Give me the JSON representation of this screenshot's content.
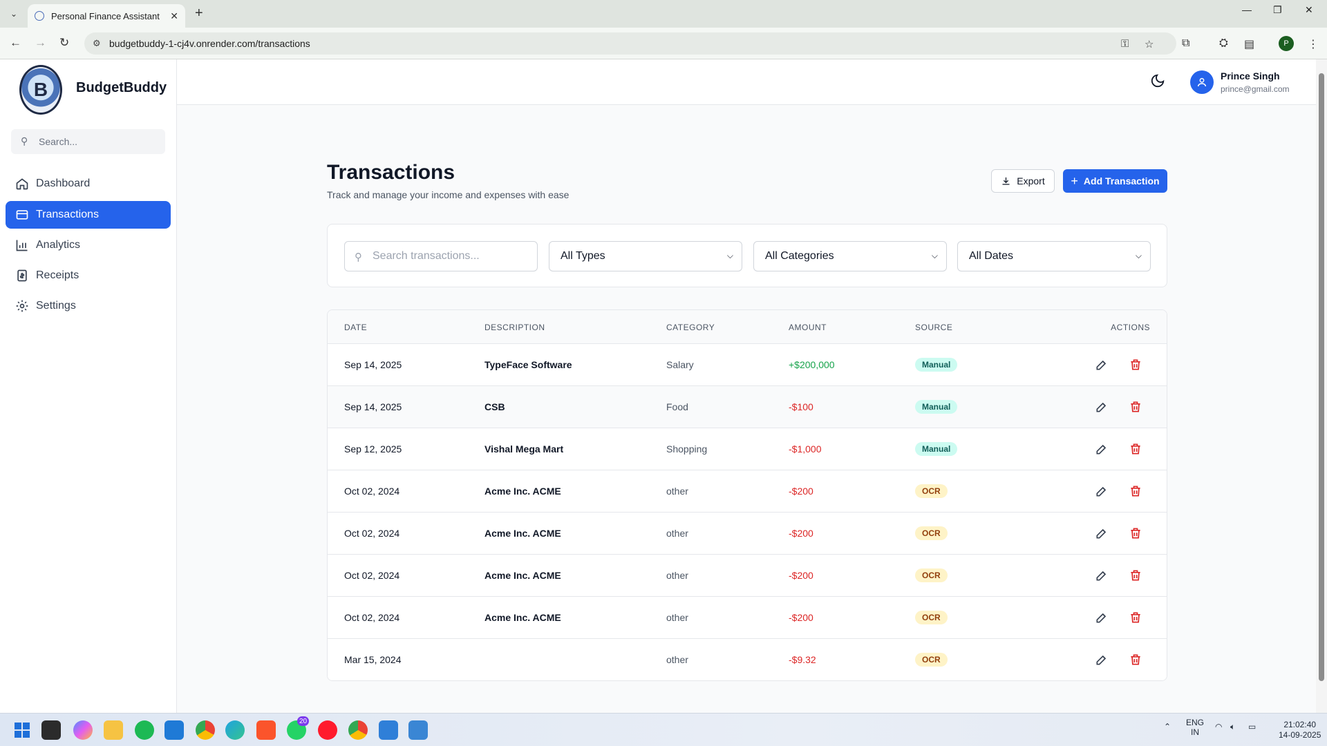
{
  "browser": {
    "tab_title": "Personal Finance Assistant",
    "url": "budgetbuddy-1-cj4v.onrender.com/transactions",
    "profile_initial": "P"
  },
  "sidebar": {
    "brand": "BudgetBuddy",
    "search_placeholder": "Search...",
    "items": [
      {
        "label": "Dashboard",
        "icon": "home-icon"
      },
      {
        "label": "Transactions",
        "icon": "card-icon",
        "active": true
      },
      {
        "label": "Analytics",
        "icon": "bar-chart-icon"
      },
      {
        "label": "Receipts",
        "icon": "receipt-icon"
      },
      {
        "label": "Settings",
        "icon": "gear-icon"
      }
    ]
  },
  "user": {
    "name": "Prince Singh",
    "email": "prince@gmail.com"
  },
  "page": {
    "title": "Transactions",
    "subtitle": "Track and manage your income and expenses with ease",
    "export_label": "Export",
    "add_label": "Add Transaction"
  },
  "filters": {
    "search_placeholder": "Search transactions...",
    "type": "All Types",
    "category": "All Categories",
    "date": "All Dates"
  },
  "table": {
    "headers": [
      "DATE",
      "DESCRIPTION",
      "CATEGORY",
      "AMOUNT",
      "SOURCE",
      "ACTIONS"
    ],
    "rows": [
      {
        "date": "Sep 14, 2025",
        "description": "TypeFace Software",
        "category": "Salary",
        "amount": "+$200,000",
        "source": "Manual"
      },
      {
        "date": "Sep 14, 2025",
        "description": "CSB",
        "category": "Food",
        "amount": "-$100",
        "source": "Manual"
      },
      {
        "date": "Sep 12, 2025",
        "description": "Vishal Mega Mart",
        "category": "Shopping",
        "amount": "-$1,000",
        "source": "Manual"
      },
      {
        "date": "Oct 02, 2024",
        "description": "Acme Inc. ACME",
        "category": "other",
        "amount": "-$200",
        "source": "OCR"
      },
      {
        "date": "Oct 02, 2024",
        "description": "Acme Inc. ACME",
        "category": "other",
        "amount": "-$200",
        "source": "OCR"
      },
      {
        "date": "Oct 02, 2024",
        "description": "Acme Inc. ACME",
        "category": "other",
        "amount": "-$200",
        "source": "OCR"
      },
      {
        "date": "Oct 02, 2024",
        "description": "Acme Inc. ACME",
        "category": "other",
        "amount": "-$200",
        "source": "OCR"
      },
      {
        "date": "Mar 15, 2024",
        "description": "",
        "category": "other",
        "amount": "-$9.32",
        "source": "OCR"
      }
    ]
  },
  "colors": {
    "accent": "#2563eb",
    "income": "#16a34a",
    "expense": "#dc2626"
  },
  "taskbar": {
    "whatsapp_badge": "20",
    "lang_top": "ENG",
    "lang_bottom": "IN",
    "time": "21:02:40",
    "date": "14-09-2025"
  }
}
